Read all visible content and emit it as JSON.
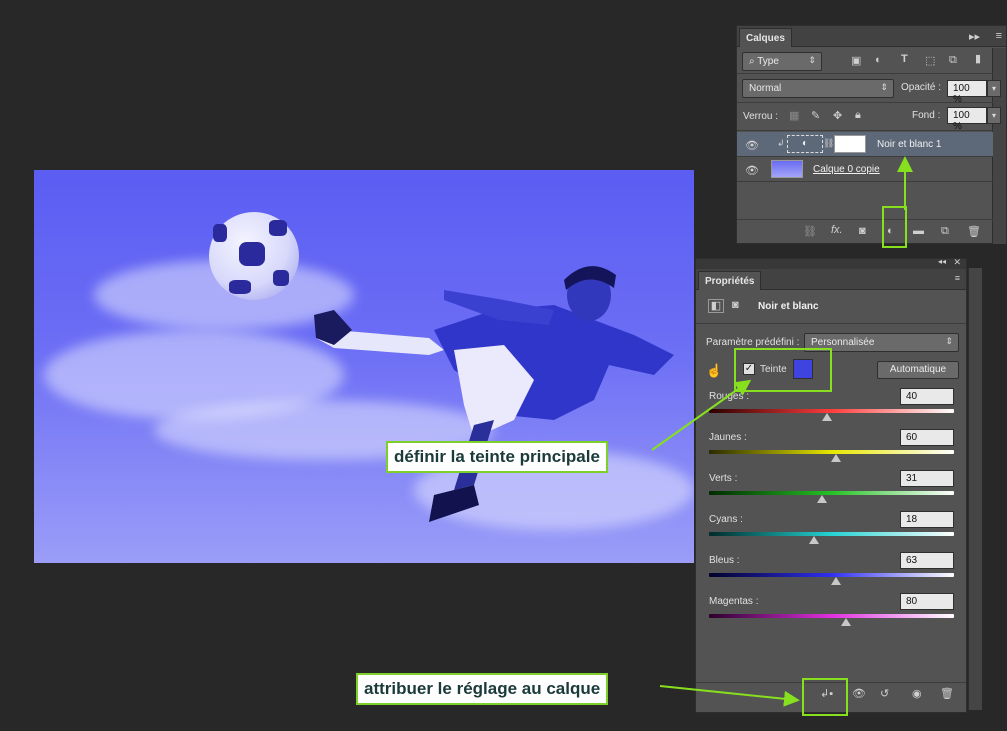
{
  "layers_panel": {
    "tab": "Calques",
    "filter_type": "Type",
    "blend_mode": "Normal",
    "opacity_label": "Opacité :",
    "opacity_value": "100 %",
    "lock_label": "Verrou :",
    "fill_label": "Fond :",
    "fill_value": "100 %",
    "layers": [
      {
        "name": "Noir et blanc 1",
        "selected": true
      },
      {
        "name": "Calque 0 copie",
        "selected": false
      }
    ]
  },
  "properties_panel": {
    "tab": "Propriétés",
    "title": "Noir et blanc",
    "preset_label": "Paramètre prédéfini :",
    "preset_value": "Personnalisée",
    "tint_label": "Teinte",
    "tint_checked": true,
    "tint_color": "#3f44e0",
    "auto_button": "Automatique",
    "sliders": [
      {
        "label": "Rouges :",
        "value": "40",
        "pos": 0.48,
        "gradient": "linear-gradient(90deg,#2a0000,#ff3c3c,#ffffff)"
      },
      {
        "label": "Jaunes :",
        "value": "60",
        "pos": 0.52,
        "gradient": "linear-gradient(90deg,#2a2a00,#e6e600,#ffffff)"
      },
      {
        "label": "Verts :",
        "value": "31",
        "pos": 0.46,
        "gradient": "linear-gradient(90deg,#002a00,#25c225,#ffffff)"
      },
      {
        "label": "Cyans :",
        "value": "18",
        "pos": 0.43,
        "gradient": "linear-gradient(90deg,#002a2a,#25d2d2,#ffffff)"
      },
      {
        "label": "Bleus :",
        "value": "63",
        "pos": 0.52,
        "gradient": "linear-gradient(90deg,#00002a,#3030f0,#ffffff)"
      },
      {
        "label": "Magentas :",
        "value": "80",
        "pos": 0.56,
        "gradient": "linear-gradient(90deg,#2a002a,#e030e0,#ffffff)"
      }
    ]
  },
  "callouts": {
    "tint": "définir la teinte principale",
    "clip": "attribuer le réglage au calque"
  },
  "colors": {
    "accent_green": "#86e01e",
    "canvas_blue": "#5b5df3"
  }
}
